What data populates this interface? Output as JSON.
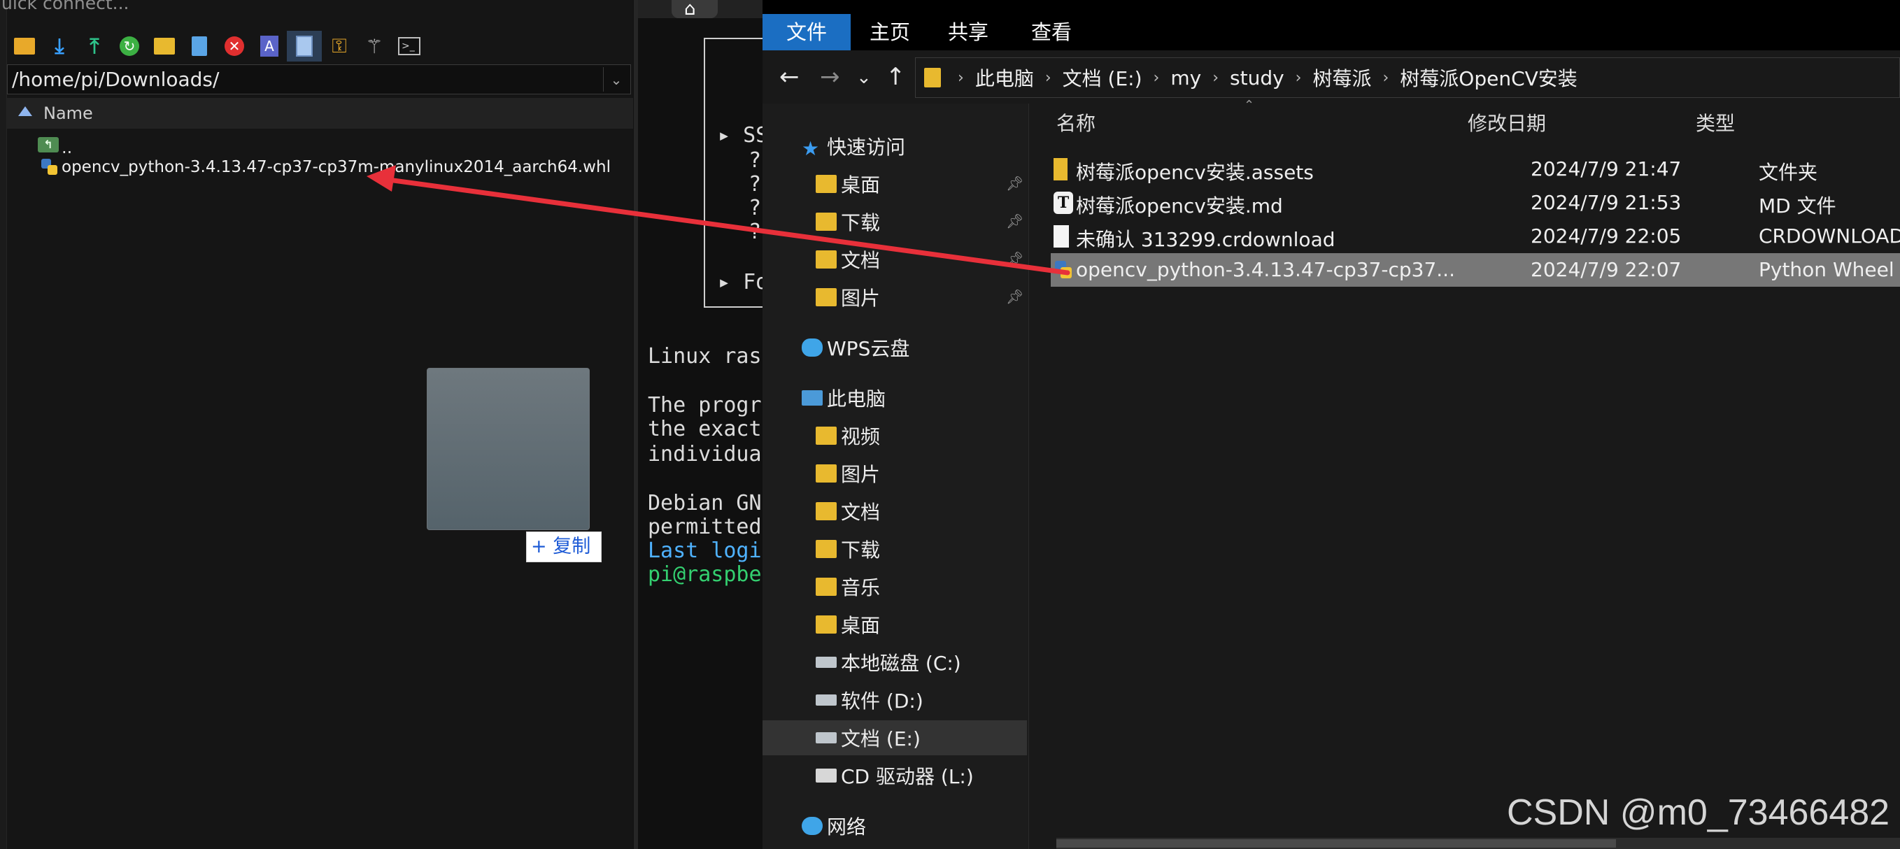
{
  "sftp": {
    "quick_connect": "uick connect...",
    "path": "/home/pi/Downloads/",
    "column_name": "Name",
    "parent_dir": "..",
    "files": [
      {
        "name": "opencv_python-3.4.13.47-cp37-cp37m-manylinux2014_aarch64.whl"
      }
    ],
    "copy_tooltip": "+ 复制"
  },
  "terminal": {
    "lines": [
      "▸ SS",
      "?",
      "?",
      "?",
      "?",
      "▸ Fo",
      "Linux rasp",
      "The progra",
      "the exact",
      "individual",
      "Debian GNU",
      "permitted",
      "Last login",
      "pi@raspber"
    ]
  },
  "explorer": {
    "tabs": {
      "file": "文件",
      "home": "主页",
      "share": "共享",
      "view": "查看"
    },
    "breadcrumb": [
      "此电脑",
      "文档 (E:)",
      "my",
      "study",
      "树莓派",
      "树莓派OpenCV安装"
    ],
    "nav": {
      "quick_access": "快速访问",
      "qa_items": [
        "桌面",
        "下载",
        "文档",
        "图片"
      ],
      "wps": "WPS云盘",
      "this_pc": "此电脑",
      "pc_items": [
        "视频",
        "图片",
        "文档",
        "下载",
        "音乐",
        "桌面",
        "本地磁盘 (C:)",
        "软件 (D:)",
        "文档 (E:)",
        "CD 驱动器 (L:)"
      ],
      "network": "网络"
    },
    "columns": {
      "name": "名称",
      "date": "修改日期",
      "type": "类型"
    },
    "files": [
      {
        "name": "树莓派opencv安装.assets",
        "date": "2024/7/9 21:47",
        "type": "文件夹"
      },
      {
        "name": "树莓派opencv安装.md",
        "date": "2024/7/9 21:53",
        "type": "MD 文件"
      },
      {
        "name": "未确认 313299.crdownload",
        "date": "2024/7/9 22:05",
        "type": "CRDOWNLOAD ..."
      },
      {
        "name": "opencv_python-3.4.13.47-cp37-cp37...",
        "date": "2024/7/9 22:07",
        "type": "Python Wheel"
      }
    ]
  },
  "watermark": "CSDN @m0_73466482",
  "colors": {
    "arrow": "#e8303a",
    "ribbon_active": "#1b6ec2",
    "selected_row": "#777777"
  }
}
